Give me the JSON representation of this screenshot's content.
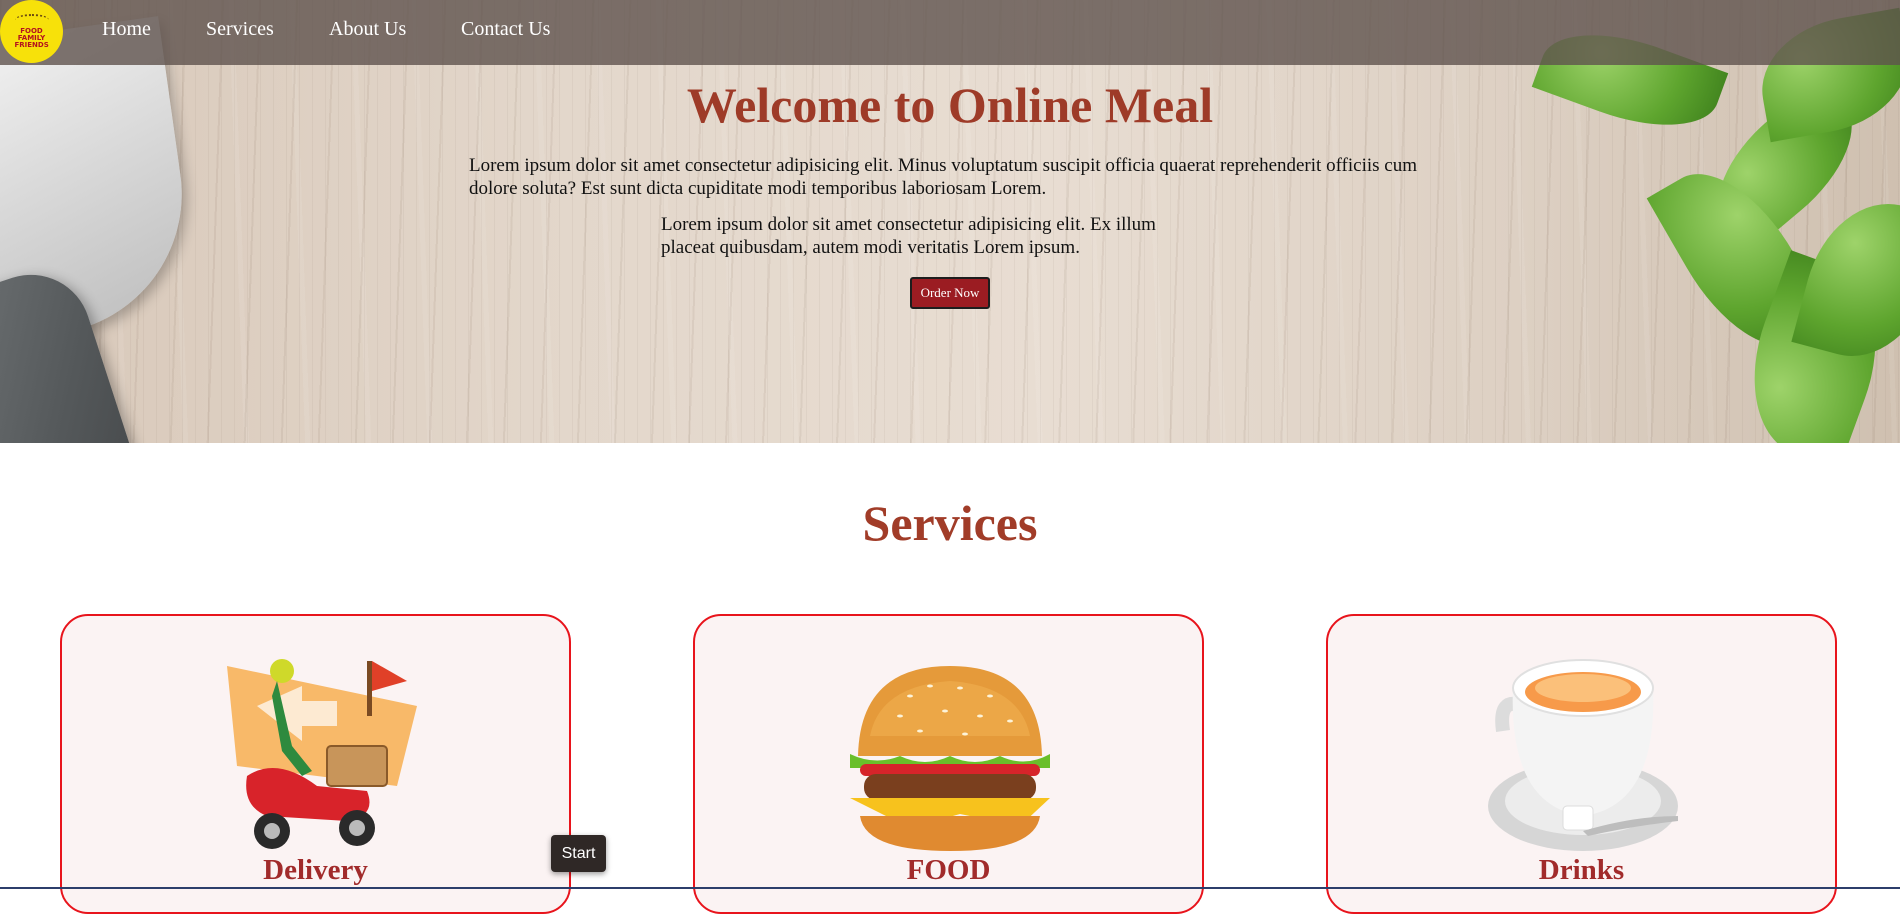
{
  "logo": {
    "text": "FOOD FAMILY FRIENDS"
  },
  "nav": {
    "items": [
      {
        "label": "Home"
      },
      {
        "label": "Services"
      },
      {
        "label": "About Us"
      },
      {
        "label": "Contact Us"
      }
    ]
  },
  "hero": {
    "title": "Welcome to Online Meal",
    "paragraph1": "Lorem ipsum dolor sit amet consectetur adipisicing elit. Minus voluptatum suscipit officia quaerat reprehenderit officiis cum dolore soluta? Est sunt dicta cupiditate modi temporibus laboriosam Lorem.",
    "paragraph2": "Lorem ipsum dolor sit amet consectetur adipisicing elit. Ex illum placeat quibusdam, autem modi veritatis Lorem ipsum.",
    "button_label": "Order Now"
  },
  "services": {
    "title": "Services",
    "cards": [
      {
        "label": "Delivery",
        "icon": "delivery-scooter-icon"
      },
      {
        "label": "FOOD",
        "icon": "burger-icon"
      },
      {
        "label": "Drinks",
        "icon": "tea-cup-icon"
      }
    ]
  },
  "overlay": {
    "start_label": "Start"
  },
  "colors": {
    "accent": "#a13c28",
    "button": "#9b1c22",
    "card_border": "#e8141c",
    "card_bg": "#fbf3f3",
    "nav_bg": "#5f524e"
  }
}
